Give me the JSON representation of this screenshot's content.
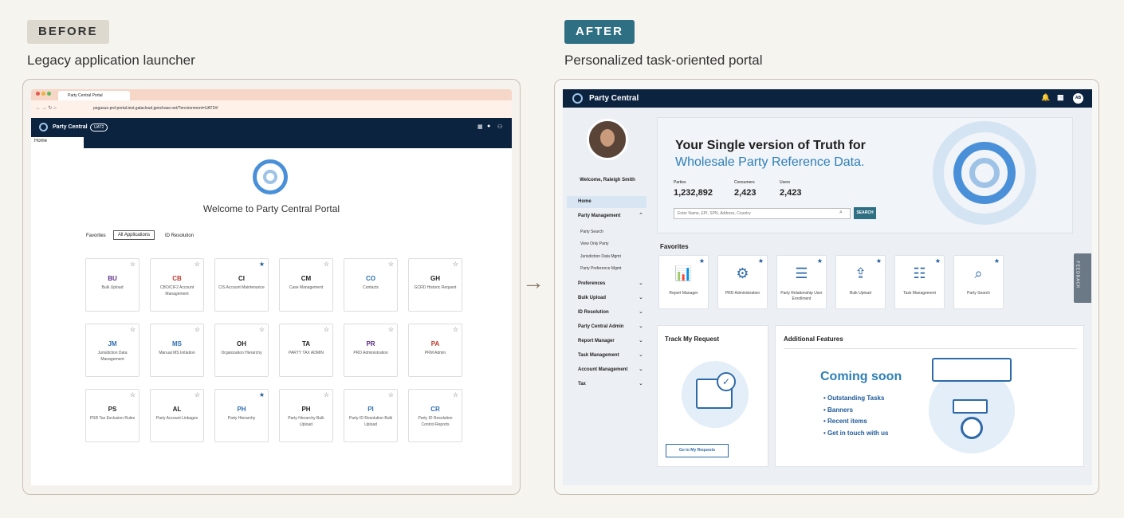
{
  "before": {
    "tag": "BEFORE",
    "subtitle": "Legacy application launcher",
    "browser_tab": "Party Central Portal",
    "url": "pegasus-prd-portal.test.galacloud.jpmchase.net/?environment=UAT2#/",
    "app_name": "Party Central",
    "env_badge": "UAT2",
    "home_tab": "Home",
    "welcome": "Welcome to Party Central Portal",
    "filters": [
      "Favorites",
      "All Applications",
      "ID Resolution"
    ],
    "tiles": [
      {
        "code": "BU",
        "name": "Bulk Upload",
        "color": "#5b2c83",
        "star": false
      },
      {
        "code": "CB",
        "name": "CBO/CIF2 Account Management",
        "color": "#c0392b",
        "star": false
      },
      {
        "code": "CI",
        "name": "CIS Account Maintenance",
        "color": "#222",
        "star": true
      },
      {
        "code": "CM",
        "name": "Case Management",
        "color": "#222",
        "star": false
      },
      {
        "code": "CO",
        "name": "Contacts",
        "color": "#2e6fb0",
        "star": false
      },
      {
        "code": "GH",
        "name": "GCRD Historic Request",
        "color": "#222",
        "star": false
      },
      {
        "code": "JM",
        "name": "Jurisdiction Data Management",
        "color": "#2e6fb0",
        "star": false
      },
      {
        "code": "MS",
        "name": "Manual MS Initiation",
        "color": "#2e6fb0",
        "star": false
      },
      {
        "code": "OH",
        "name": "Organization Hierarchy",
        "color": "#222",
        "star": false
      },
      {
        "code": "TA",
        "name": "PARTY TAX ADMIN",
        "color": "#222",
        "star": false
      },
      {
        "code": "PR",
        "name": "PRD Administration",
        "color": "#5b2c83",
        "star": false
      },
      {
        "code": "PA",
        "name": "PRM Admin",
        "color": "#c0392b",
        "star": false
      },
      {
        "code": "PS",
        "name": "PSR Tax Exclusion Rules",
        "color": "#222",
        "star": false
      },
      {
        "code": "AL",
        "name": "Party Account Linkages",
        "color": "#222",
        "star": false
      },
      {
        "code": "PH",
        "name": "Party Hierarchy",
        "color": "#2e6fb0",
        "star": true
      },
      {
        "code": "PH",
        "name": "Party Hierarchy Bulk Upload",
        "color": "#222",
        "star": false
      },
      {
        "code": "PI",
        "name": "Party ID Resolution Bulk Upload",
        "color": "#2e6fb0",
        "star": false
      },
      {
        "code": "CR",
        "name": "Party ID Resolution Control Reports",
        "color": "#2e6fb0",
        "star": false
      }
    ]
  },
  "arrow": "→",
  "after": {
    "tag": "AFTER",
    "subtitle": "Personalized task-oriented portal",
    "app_name": "Party Central",
    "avatar_initials": "AB",
    "welcome_user": "Welcome, Raleigh Smith",
    "sidebar": [
      {
        "label": "Home",
        "active": true
      },
      {
        "label": "Party Management",
        "expanded": true
      },
      {
        "label": "Preferences"
      },
      {
        "label": "Bulk Upload"
      },
      {
        "label": "ID Resolution"
      },
      {
        "label": "Party Central Admin"
      },
      {
        "label": "Report Manager"
      },
      {
        "label": "Task Management"
      },
      {
        "label": "Account Management"
      },
      {
        "label": "Tax"
      }
    ],
    "sidebar_sub": [
      "Party Search",
      "View Only Party",
      "Jurisdiction Data Mgmt",
      "Party Preference Mgmt"
    ],
    "hero": {
      "line1": "Your Single version of Truth for",
      "line2": "Wholesale Party Reference Data.",
      "stats": [
        {
          "label": "Parties",
          "value": "1,232,892"
        },
        {
          "label": "Consumers",
          "value": "2,423"
        },
        {
          "label": "Users",
          "value": "2,423"
        }
      ],
      "search_placeholder": "Enter Name, EPI, SPN, Address, Country",
      "search_button": "SEARCH"
    },
    "favorites_title": "Favorites",
    "favorites": [
      {
        "label": "Report Manager",
        "icon": "📊"
      },
      {
        "label": "PRD Administration",
        "icon": "⚙"
      },
      {
        "label": "Party Relationship User Enrollment",
        "icon": "☰"
      },
      {
        "label": "Bulk Upload",
        "icon": "⇪"
      },
      {
        "label": "Task Management",
        "icon": "☷"
      },
      {
        "label": "Party Search",
        "icon": "⌕"
      }
    ],
    "track_title": "Track My Request",
    "track_button": "Go to My Requests",
    "additional_title": "Additional Features",
    "coming_soon": "Coming soon",
    "coming_items": [
      "Outstanding Tasks",
      "Banners",
      "Recent items",
      "Get in touch with us"
    ],
    "feedback": "FEEDBACK"
  }
}
